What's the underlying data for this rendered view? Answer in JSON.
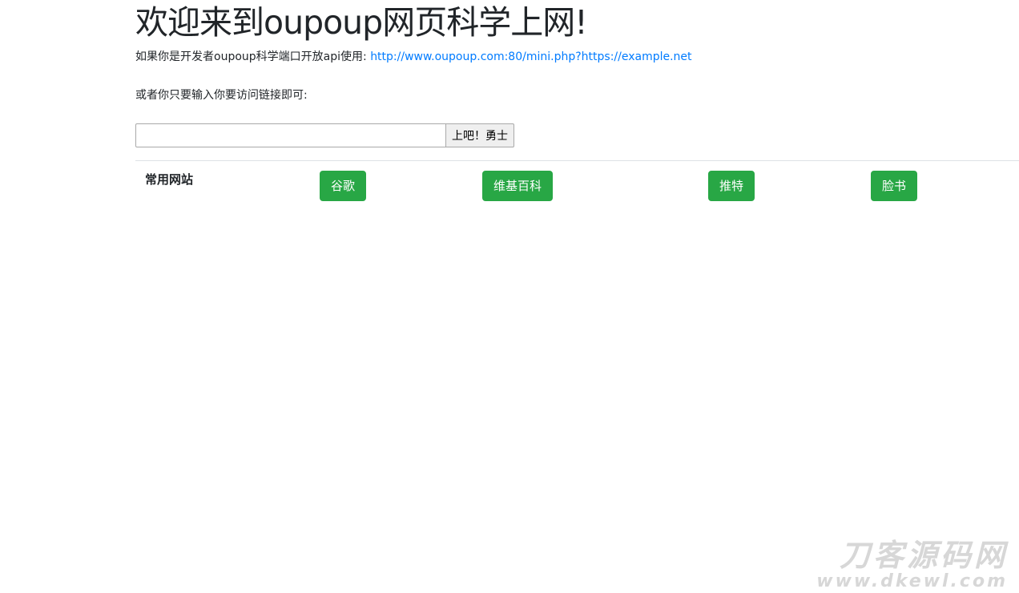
{
  "header": {
    "title": "欢迎来到oupoup网页科学上网!"
  },
  "api": {
    "prefix": "如果你是开发者oupoup科学端口开放api使用: ",
    "link_text": "http://www.oupoup.com:80/mini.php?https://example.net"
  },
  "hint": {
    "text": "或者你只要输入你要访问链接即可:"
  },
  "form": {
    "input_value": "",
    "submit_label": "上吧！勇士"
  },
  "sites": {
    "label": "常用网站",
    "items": [
      {
        "label": "谷歌"
      },
      {
        "label": "维基百科"
      },
      {
        "label": "推特"
      },
      {
        "label": "脸书"
      }
    ]
  },
  "colors": {
    "link": "#007bff",
    "button_green": "#28a745",
    "divider": "#dee2e6"
  },
  "watermark": {
    "line1": "刀客源码网",
    "line2": "www.dkewl.com"
  }
}
